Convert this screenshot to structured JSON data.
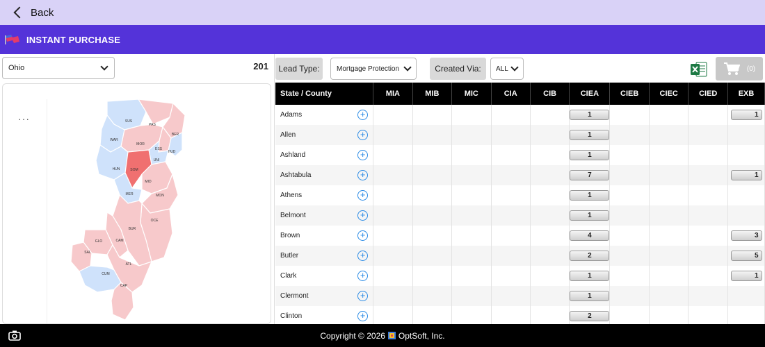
{
  "nav": {
    "back_label": "Back"
  },
  "header": {
    "title": "INSTANT PURCHASE"
  },
  "left": {
    "state_selected": "Ohio",
    "total_count": "201",
    "map_menu": "···",
    "map_labels": [
      "SUS",
      "PAS",
      "BER",
      "WAR",
      "MOR",
      "ESS",
      "HUD",
      "UNI",
      "HUN",
      "SOM",
      "MID",
      "MER",
      "MON",
      "OCE",
      "BUR",
      "GLO",
      "CAM",
      "SAL",
      "ATL",
      "CUM",
      "CAP"
    ]
  },
  "filters": {
    "lead_type_label": "Lead Type:",
    "lead_type_value": "Mortgage Protection",
    "created_via_label": "Created Via:",
    "created_via_value": "ALL",
    "cart_count": "(0)"
  },
  "table": {
    "columns": [
      "State / County",
      "MIA",
      "MIB",
      "MIC",
      "CIA",
      "CIB",
      "CIEA",
      "CIEB",
      "CIEC",
      "CIED",
      "EXB"
    ],
    "rows": [
      {
        "county": "Adams",
        "ciea": "1",
        "exb": "1"
      },
      {
        "county": "Allen",
        "ciea": "1",
        "exb": ""
      },
      {
        "county": "Ashland",
        "ciea": "1",
        "exb": ""
      },
      {
        "county": "Ashtabula",
        "ciea": "7",
        "exb": "1"
      },
      {
        "county": "Athens",
        "ciea": "1",
        "exb": ""
      },
      {
        "county": "Belmont",
        "ciea": "1",
        "exb": ""
      },
      {
        "county": "Brown",
        "ciea": "4",
        "exb": "3"
      },
      {
        "county": "Butler",
        "ciea": "2",
        "exb": "5"
      },
      {
        "county": "Clark",
        "ciea": "1",
        "exb": "1"
      },
      {
        "county": "Clermont",
        "ciea": "1",
        "exb": ""
      },
      {
        "county": "Clinton",
        "ciea": "2",
        "exb": ""
      }
    ]
  },
  "footer": {
    "copyright_prefix": "Copyright © 2026",
    "company": "OptSoft, Inc."
  },
  "colors": {
    "accent": "#5433d9",
    "nav_bg": "#d9d2f7",
    "map_blue": "#cfe2fb",
    "map_pink": "#f7c9cb",
    "map_selected": "#f07070",
    "link_blue": "#2a8be6"
  }
}
